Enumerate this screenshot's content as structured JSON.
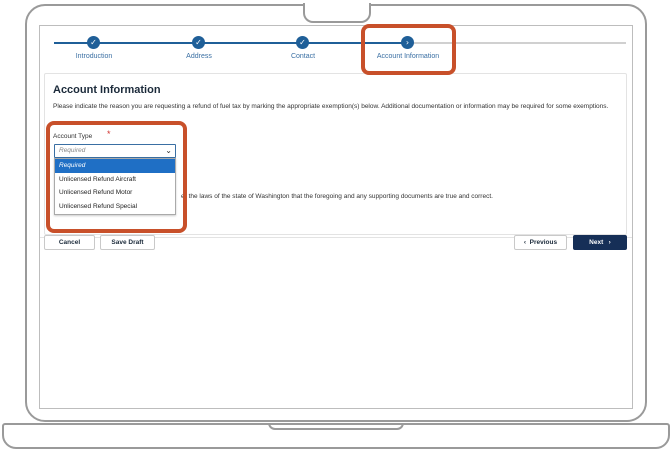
{
  "stepper": {
    "steps": [
      {
        "label": "Introduction",
        "icon": "check-icon",
        "status": "complete"
      },
      {
        "label": "Address",
        "icon": "check-icon",
        "status": "complete"
      },
      {
        "label": "Contact",
        "icon": "check-icon",
        "status": "complete"
      },
      {
        "label": "Account Information",
        "icon": "chevron-right-icon",
        "status": "current"
      }
    ]
  },
  "form": {
    "title": "Account Information",
    "description": "Please indicate the reason you are requesting a refund of fuel tax by marking the appropriate exemption(s) below. Additional documentation or information may be required for some exemptions.",
    "account_type_label": "Account Type",
    "required_mark": "*",
    "account_type_placeholder": "Required",
    "options": [
      "Required",
      "Unlicensed Refund Aircraft",
      "Unlicensed Refund Motor",
      "Unlicensed Refund Special"
    ],
    "certification_text_visible": "er the laws of the state of Washington that the foregoing and any supporting documents are true and correct."
  },
  "actions": {
    "cancel": "Cancel",
    "save_draft": "Save Draft",
    "previous": "Previous",
    "next": "Next"
  },
  "colors": {
    "brand": "#1f5f98",
    "primary_button": "#162f57",
    "selected_option": "#1f6fc5",
    "callout": "#c8502a",
    "required": "#d0312d"
  }
}
